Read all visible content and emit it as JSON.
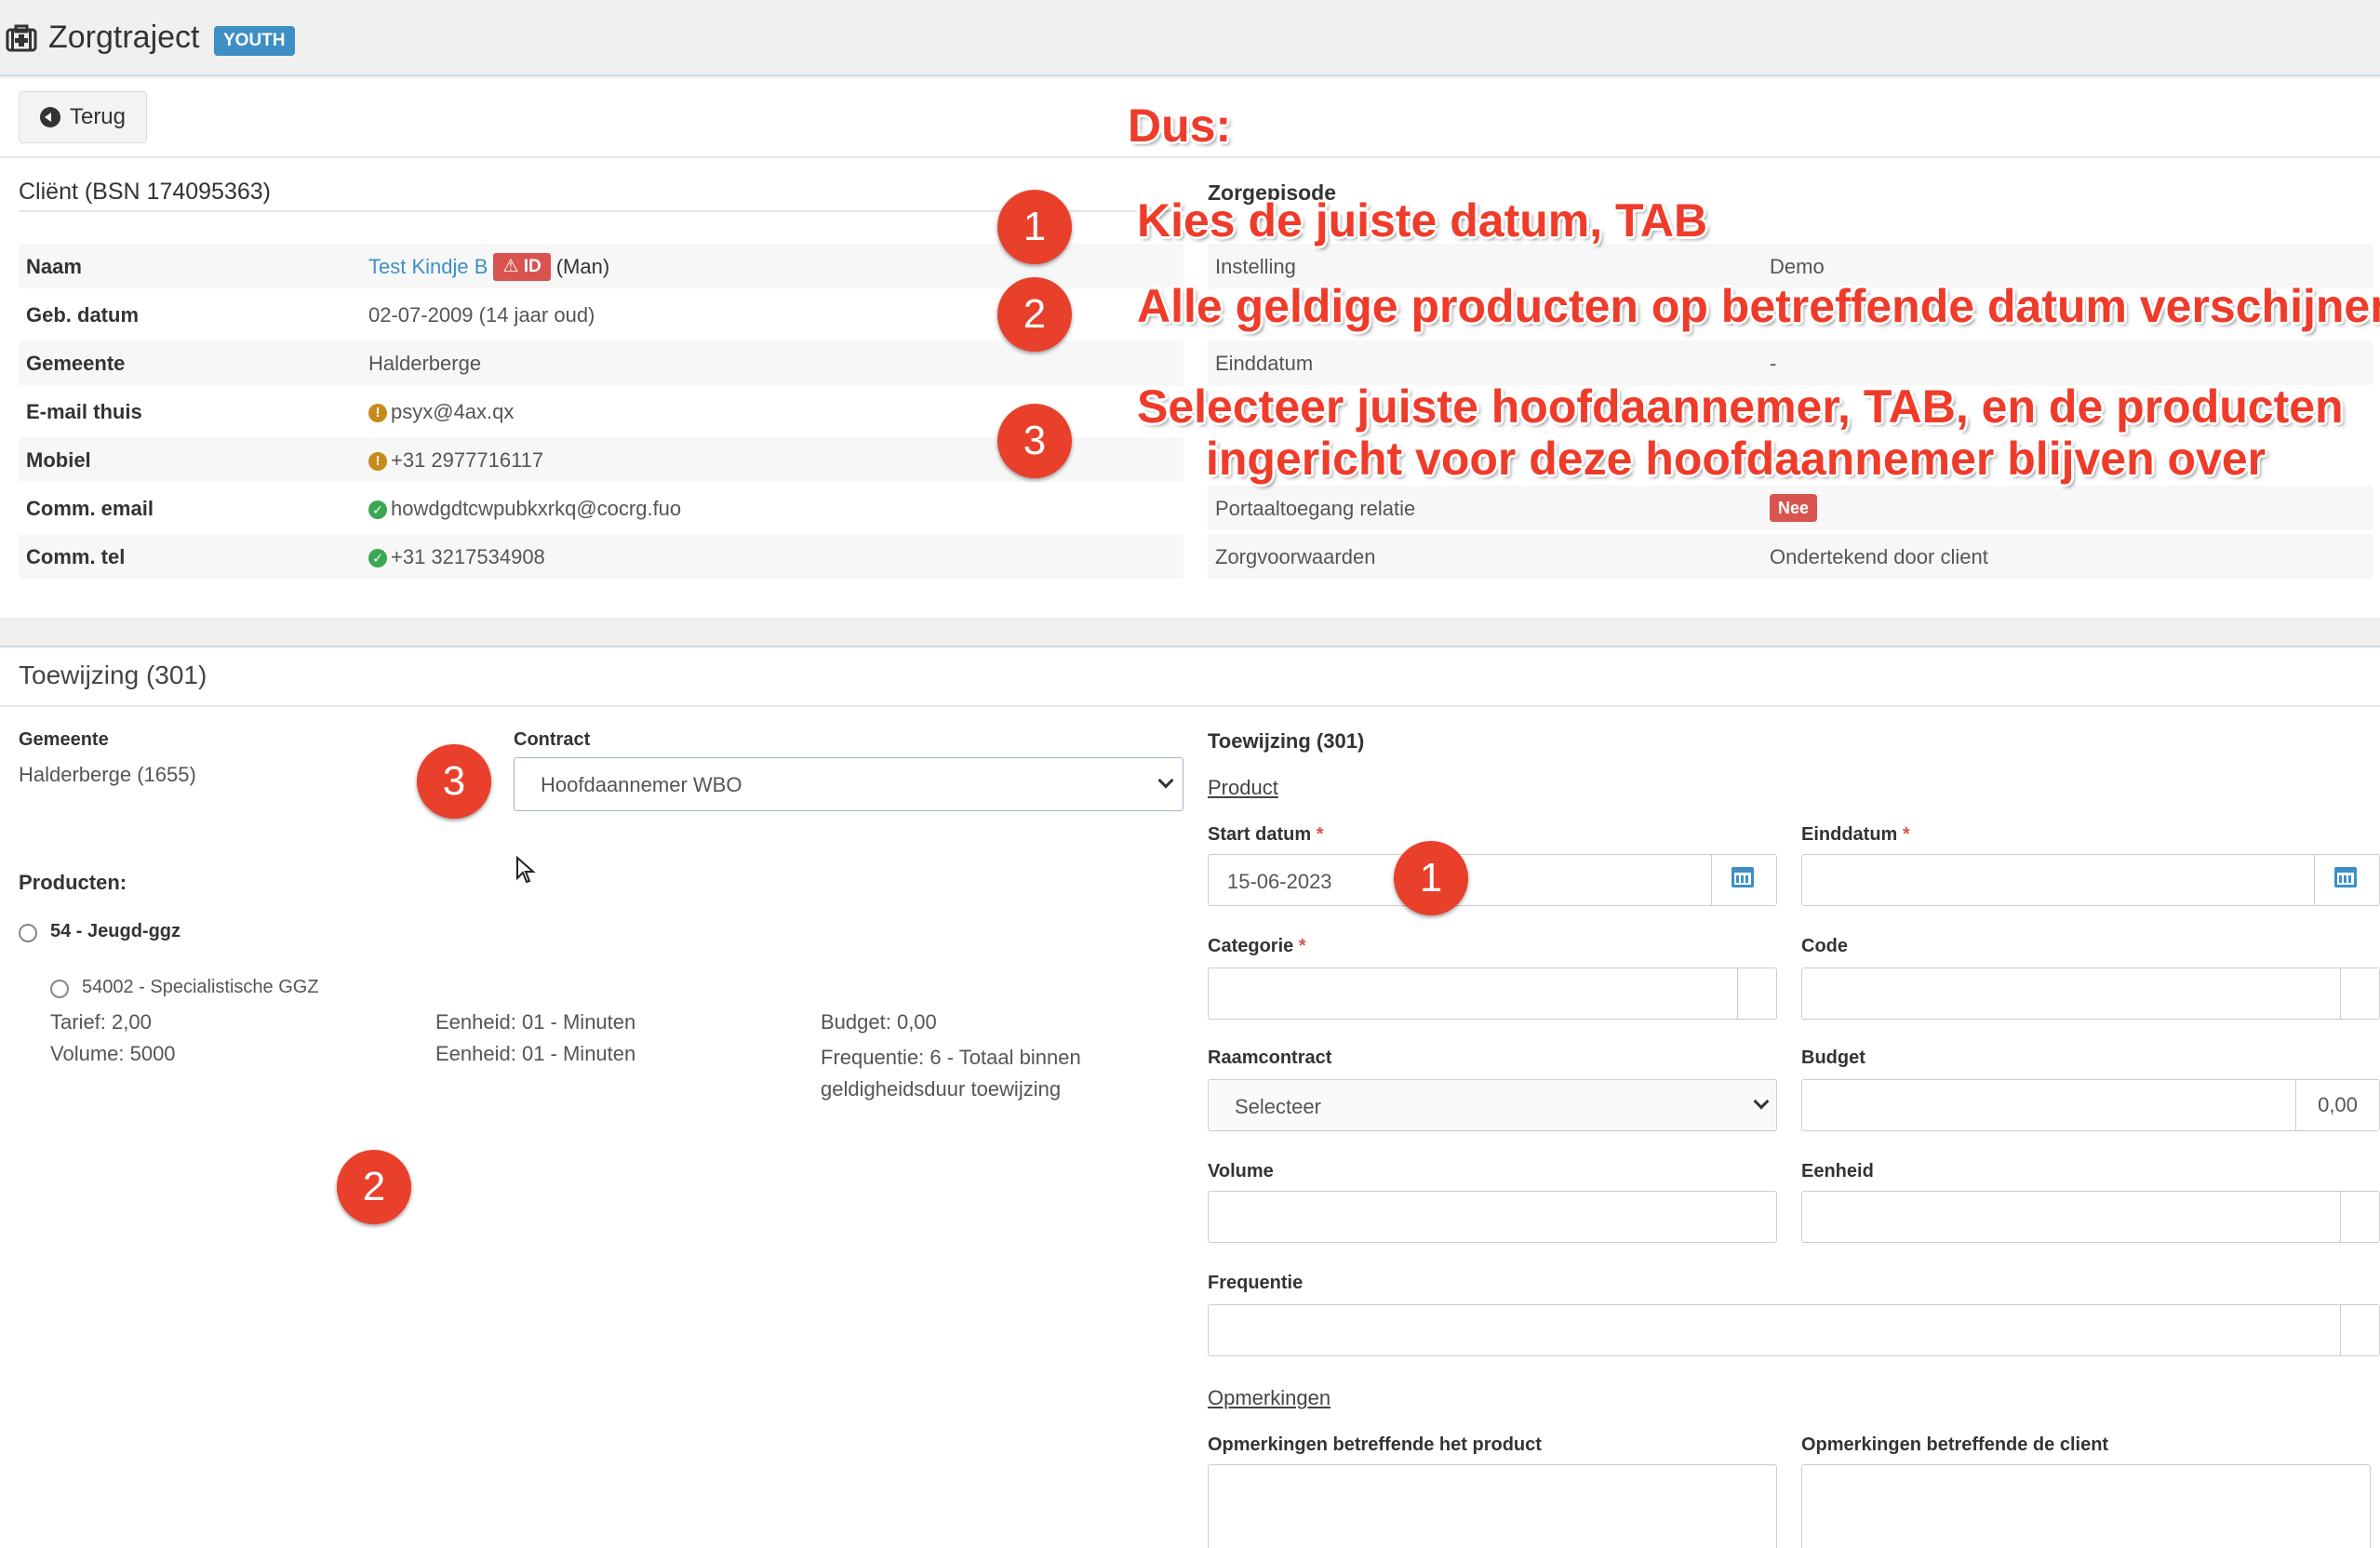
{
  "header": {
    "title": "Zorgtraject",
    "badge": "YOUTH"
  },
  "back_button": {
    "label": "Terug"
  },
  "client": {
    "title": "Cliënt (BSN 174095363)",
    "rows": [
      {
        "label": "Naam",
        "value_link": "Test Kindje B",
        "id_badge": "ID",
        "value_suffix": "(Man)"
      },
      {
        "label": "Geb. datum",
        "value": "02-07-2009 (14 jaar oud)"
      },
      {
        "label": "Gemeente",
        "value": "Halderberge"
      },
      {
        "label": "E-mail thuis",
        "value": "psyx@4ax.qx",
        "icon": "warning"
      },
      {
        "label": "Mobiel",
        "value": "+31 2977716117",
        "icon": "warning"
      },
      {
        "label": "Comm. email",
        "value": "howdgdtcwpubkxrkq@cocrg.fuo",
        "icon": "check"
      },
      {
        "label": "Comm. tel",
        "value": "+31 3217534908",
        "icon": "check"
      }
    ]
  },
  "zorgepisode": {
    "title": "Zorgepisode",
    "rows": [
      {
        "label": "Instelling",
        "value": "Demo"
      },
      {
        "label": "Einddatum",
        "value": "-"
      },
      {
        "label": "Portaaltoegang relatie",
        "badge": "Nee"
      },
      {
        "label": "Zorgvoorwaarden",
        "value": "Ondertekend door client"
      }
    ]
  },
  "toewijzing": {
    "title": "Toewijzing (301)",
    "gemeente_label": "Gemeente",
    "gemeente_value": "Halderberge (1655)",
    "contract_label": "Contract",
    "contract_value": "Hoofdaannemer WBO",
    "producten_label": "Producten:",
    "product_group": "54 - Jeugd-ggz",
    "product": {
      "name": "54002 - Specialistische GGZ",
      "tarief": "Tarief: 2,00",
      "volume": "Volume: 5000",
      "eenheid1": "Eenheid: 01 - Minuten",
      "eenheid2": "Eenheid: 01 - Minuten",
      "budget": "Budget: 0,00",
      "frequentie": "Frequentie: 6 - Totaal binnen geldigheidsduur toewijzing"
    }
  },
  "form": {
    "title": "Toewijzing (301)",
    "product_link": "Product",
    "start_label": "Start datum",
    "start_value": "15-06-2023",
    "eind_label": "Einddatum",
    "categorie_label": "Categorie",
    "code_label": "Code",
    "raamcontract_label": "Raamcontract",
    "raamcontract_value": "Selecteer",
    "budget_label": "Budget",
    "budget_value": "0,00",
    "volume_label": "Volume",
    "eenheid_label": "Eenheid",
    "frequentie_label": "Frequentie",
    "opmerkingen_link": "Opmerkingen",
    "opm_product_label": "Opmerkingen betreffende het product",
    "opm_client_label": "Opmerkingen betreffende de client",
    "required_mark": "*"
  },
  "annotations": {
    "heading": "Dus:",
    "steps": [
      {
        "num": "1",
        "text": "Kies de juiste datum, TAB"
      },
      {
        "num": "2",
        "text": "Alle geldige producten op betreffende datum verschijnen"
      },
      {
        "num": "3",
        "text_line1": "Selecteer juiste hoofdaannemer, TAB, en de producten",
        "text_line2": "ingericht voor deze hoofdaannemer blijven over"
      }
    ]
  },
  "colors": {
    "accent": "#3d8fc6",
    "annotation_red": "#ef3b2a",
    "badge_red": "#d9534f"
  }
}
